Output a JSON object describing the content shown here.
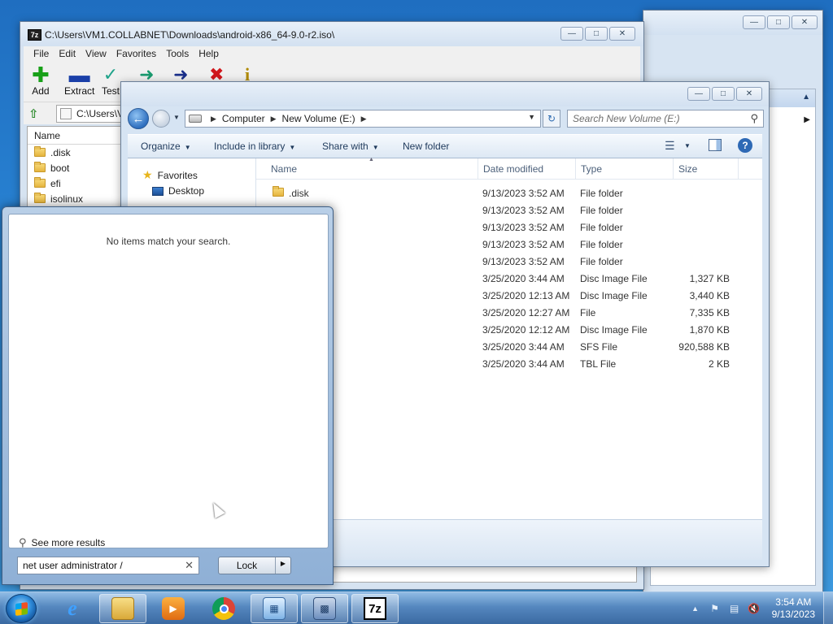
{
  "zip": {
    "title": "C:\\Users\\VM1.COLLABNET\\Downloads\\android-x86_64-9.0-r2.iso\\",
    "app_icon": "7z",
    "menu": [
      "File",
      "Edit",
      "View",
      "Favorites",
      "Tools",
      "Help"
    ],
    "toolbar": [
      "Add",
      "Extract",
      "Test",
      "Copy",
      "Move",
      "Delete",
      "Info"
    ],
    "toolbar_visible_labels": [
      "Add",
      "Extract",
      "Test"
    ],
    "address": "C:\\Users\\VM1.COLLABNET\\Downloads\\android-x86_64-9.0-r2.iso\\",
    "address_visible": "C:\\Users\\V",
    "list_header": "Name",
    "items": [
      ".disk",
      "boot",
      "efi",
      "isolinux"
    ]
  },
  "explorer": {
    "breadcrumbs": [
      "Computer",
      "New Volume (E:)"
    ],
    "search_placeholder": "Search New Volume (E:)",
    "commands": [
      "Organize",
      "Include in library",
      "Share with",
      "New folder"
    ],
    "nav": {
      "favorites_label": "Favorites",
      "items": [
        "Desktop"
      ]
    },
    "columns": [
      "Name",
      "Date modified",
      "Type",
      "Size"
    ],
    "files": [
      {
        "name": ".disk",
        "date": "9/13/2023 3:52 AM",
        "type": "File folder",
        "size": ""
      },
      {
        "name": "",
        "date": "9/13/2023 3:52 AM",
        "type": "File folder",
        "size": ""
      },
      {
        "name": "",
        "date": "9/13/2023 3:52 AM",
        "type": "File folder",
        "size": ""
      },
      {
        "name": "",
        "date": "9/13/2023 3:52 AM",
        "type": "File folder",
        "size": ""
      },
      {
        "name": "",
        "date": "9/13/2023 3:52 AM",
        "type": "File folder",
        "size": ""
      },
      {
        "name": "",
        "date": "3/25/2020 3:44 AM",
        "type": "Disc Image File",
        "size": "1,327 KB"
      },
      {
        "name": "",
        "date": "3/25/2020 12:13 AM",
        "type": "Disc Image File",
        "size": "3,440 KB"
      },
      {
        "name": "",
        "date": "3/25/2020 12:27 AM",
        "type": "File",
        "size": "7,335 KB"
      },
      {
        "name": "",
        "date": "3/25/2020 12:12 AM",
        "type": "Disc Image File",
        "size": "1,870 KB"
      },
      {
        "name": "",
        "date": "3/25/2020 3:44 AM",
        "type": "SFS File",
        "size": "920,588 KB"
      },
      {
        "name": "",
        "date": "3/25/2020 3:44 AM",
        "type": "TBL File",
        "size": "2 KB"
      }
    ]
  },
  "start_menu": {
    "no_items": "No items match your search.",
    "see_more": "See more results",
    "search_value": "net user administrator /",
    "lock_label": "Lock"
  },
  "taskbar": {
    "time": "3:54 AM",
    "date": "9/13/2023",
    "apps": [
      "internet-explorer",
      "windows-explorer",
      "media-player",
      "chrome",
      "control-panel",
      "remote-desktop",
      "7zip"
    ],
    "zip_label": "7z"
  },
  "colors": {
    "accent": "#2a6fbf",
    "add": "#18a018",
    "extract": "#1a3fa8",
    "test": "#1fa38a",
    "delete": "#d0161b",
    "info": "#d8b000"
  }
}
